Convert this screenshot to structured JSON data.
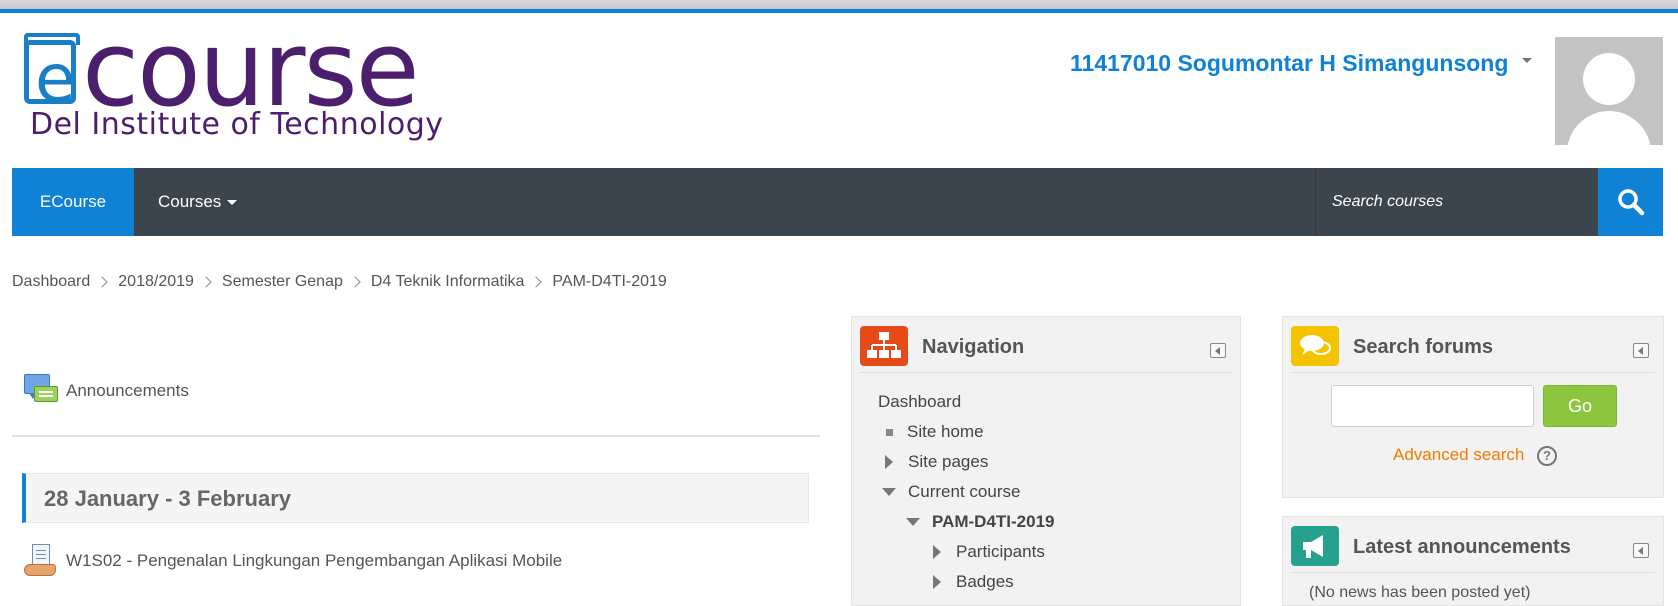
{
  "header": {
    "logo": {
      "word": "course",
      "letter": "e",
      "subtitle": "Del Institute of Technology"
    },
    "user_name": "11417010 Sogumontar H Simangunsong",
    "user_menu_icon": "caret-down-icon",
    "avatar_icon": "user-avatar-icon"
  },
  "navbar": {
    "brand": "ECourse",
    "courses_label": "Courses",
    "search_placeholder": "Search courses",
    "search_icon": "search-icon",
    "colors": {
      "bar": "#3b454d",
      "accent": "#0f82d6"
    }
  },
  "breadcrumb": [
    "Dashboard",
    "2018/2019",
    "Semester Genap",
    "D4 Teknik Informatika",
    "PAM-D4TI-2019"
  ],
  "main": {
    "announcements_label": "Announcements",
    "week_title": "28 January - 3 February",
    "activities": [
      {
        "label": "W1S02 - Pengenalan Lingkungan Pengembangan Aplikasi Mobile",
        "icon": "resource-icon"
      }
    ]
  },
  "blocks": {
    "navigation": {
      "title": "Navigation",
      "icon": "sitemap-icon",
      "items": [
        {
          "label": "Dashboard",
          "marker": "none"
        },
        {
          "label": "Site home",
          "marker": "bullet"
        },
        {
          "label": "Site pages",
          "marker": "collapsed"
        },
        {
          "label": "Current course",
          "marker": "expanded"
        },
        {
          "label": "PAM-D4TI-2019",
          "marker": "expanded",
          "bold": true
        },
        {
          "label": "Participants",
          "marker": "collapsed"
        },
        {
          "label": "Badges",
          "marker": "collapsed"
        }
      ]
    },
    "search_forums": {
      "title": "Search forums",
      "icon": "speech-bubbles-icon",
      "go_label": "Go",
      "advanced_search": "Advanced search",
      "help": "?",
      "colors": {
        "go": "#8cc63e",
        "link": "#f07c00"
      }
    },
    "latest_announcements": {
      "title": "Latest announcements",
      "icon": "megaphone-icon",
      "text": "(No news has been posted yet)"
    }
  }
}
